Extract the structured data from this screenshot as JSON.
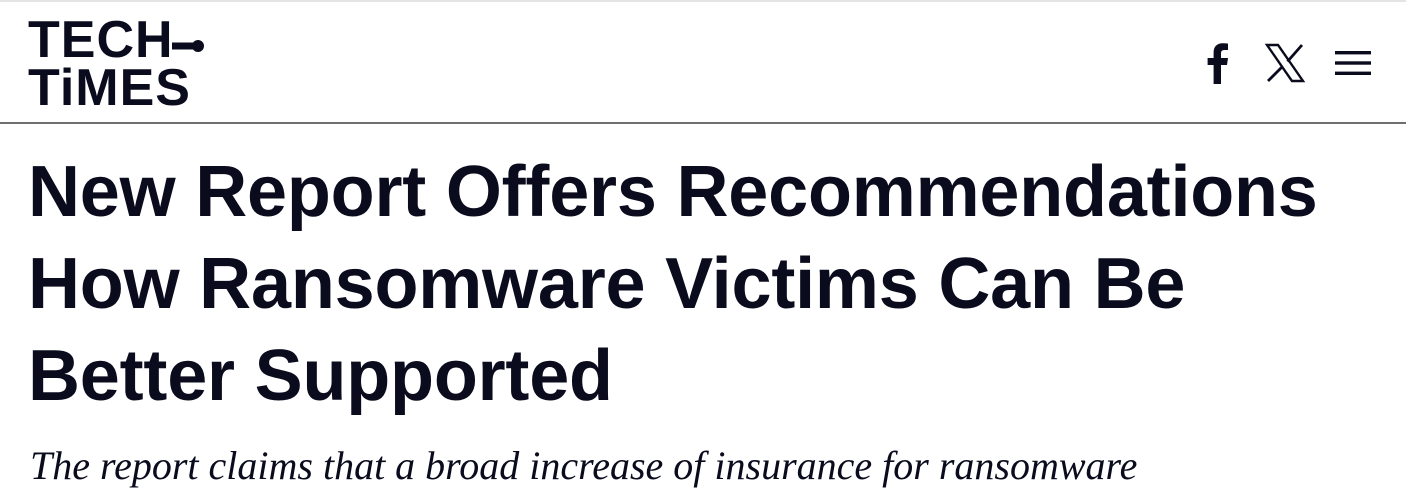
{
  "header": {
    "logo_line1": "TECH",
    "logo_line2": "TiMES",
    "icons": [
      "facebook-icon",
      "x-icon",
      "menu-icon"
    ]
  },
  "article": {
    "title": "New Report Offers Recommendations How Ransomware Victims Can Be Better Supported",
    "subtitle": "The report claims that a broad increase of insurance for ransomware"
  },
  "colors": {
    "text": "#0a0c1e",
    "background": "#ffffff",
    "header_border": "#6f6f6f"
  }
}
